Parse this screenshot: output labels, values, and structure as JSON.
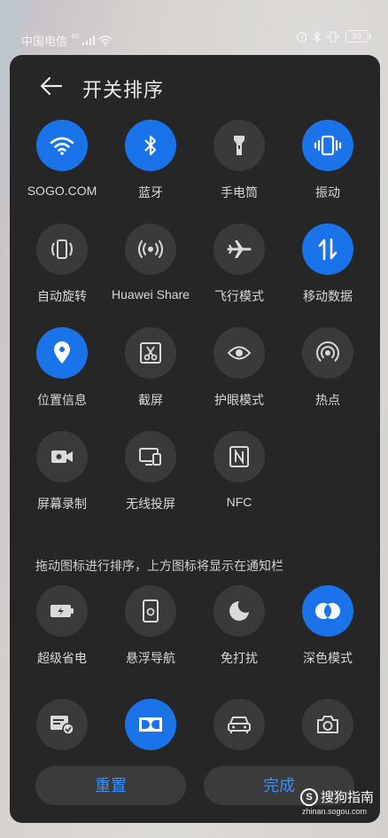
{
  "status_bar": {
    "carrier": "中国电信",
    "network": "4G",
    "battery": "89"
  },
  "header": {
    "title": "开关排序"
  },
  "active_tiles": [
    {
      "label": "SOGO.COM",
      "icon": "wifi-icon",
      "on": true
    },
    {
      "label": "蓝牙",
      "icon": "bluetooth-icon",
      "on": true
    },
    {
      "label": "手电筒",
      "icon": "flashlight-icon",
      "on": false
    },
    {
      "label": "振动",
      "icon": "vibrate-icon",
      "on": true
    },
    {
      "label": "自动旋转",
      "icon": "auto-rotate-icon",
      "on": false
    },
    {
      "label": "Huawei Share",
      "icon": "huawei-share-icon",
      "on": false
    },
    {
      "label": "飞行模式",
      "icon": "airplane-icon",
      "on": false
    },
    {
      "label": "移动数据",
      "icon": "mobile-data-icon",
      "on": true
    },
    {
      "label": "位置信息",
      "icon": "location-icon",
      "on": true
    },
    {
      "label": "截屏",
      "icon": "screenshot-icon",
      "on": false
    },
    {
      "label": "护眼模式",
      "icon": "eye-icon",
      "on": false
    },
    {
      "label": "热点",
      "icon": "hotspot-icon",
      "on": false
    },
    {
      "label": "屏幕录制",
      "icon": "screen-record-icon",
      "on": false
    },
    {
      "label": "无线投屏",
      "icon": "wireless-projection-icon",
      "on": false
    },
    {
      "label": "NFC",
      "icon": "nfc-icon",
      "on": false
    }
  ],
  "hint": "拖动图标进行排序，上方图标将显示在通知栏",
  "inactive_tiles": [
    {
      "label": "超级省电",
      "icon": "battery-saver-icon",
      "on": false
    },
    {
      "label": "悬浮导航",
      "icon": "floating-nav-icon",
      "on": false
    },
    {
      "label": "免打扰",
      "icon": "moon-icon",
      "on": false
    },
    {
      "label": "深色模式",
      "icon": "dark-mode-icon",
      "on": true
    }
  ],
  "partial_tiles": [
    {
      "icon": "card-check-icon",
      "on": false
    },
    {
      "icon": "dolby-icon",
      "on": true
    },
    {
      "icon": "car-icon",
      "on": false
    },
    {
      "icon": "camera-icon",
      "on": false
    }
  ],
  "buttons": {
    "reset": "重置",
    "done": "完成"
  },
  "watermark": {
    "brand": "搜狗指南",
    "s": "S",
    "url": "zhinan.sogou.com"
  },
  "colors": {
    "accent": "#1a73e8",
    "panel": "#262626",
    "tile": "#3a3a3a",
    "button_text": "#3b8ef0"
  }
}
